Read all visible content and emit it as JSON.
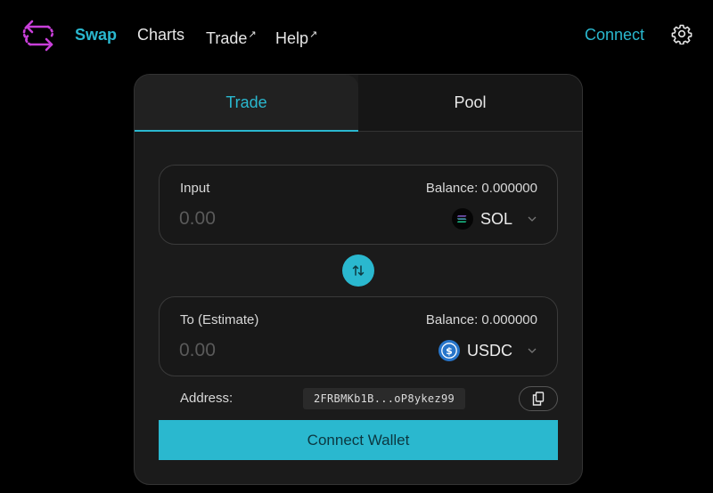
{
  "nav": {
    "swap": "Swap",
    "charts": "Charts",
    "trade": "Trade",
    "help": "Help",
    "external_mark": "↗",
    "connect": "Connect"
  },
  "tabs": {
    "trade": "Trade",
    "pool": "Pool"
  },
  "input_panel": {
    "label": "Input",
    "balance": "Balance: 0.000000",
    "amount_placeholder": "0.00",
    "token": "SOL"
  },
  "output_panel": {
    "label": "To (Estimate)",
    "balance": "Balance: 0.000000",
    "amount_placeholder": "0.00",
    "token": "USDC"
  },
  "address": {
    "label": "Address:",
    "value": "2FRBMKb1B...oP8ykez99"
  },
  "connect_wallet": "Connect Wallet",
  "colors": {
    "accent": "#2ab8cf",
    "background": "#000000",
    "card": "#1b1b1b",
    "logo": "#c83fd9"
  },
  "icons": {
    "logo": "swap-arrows-logo-icon",
    "settings": "gear-icon",
    "sol": "sol-token-icon",
    "usdc": "usdc-token-icon",
    "swap": "swap-direction-icon",
    "copy": "copy-icon",
    "dropdown": "chevron-down-icon"
  }
}
